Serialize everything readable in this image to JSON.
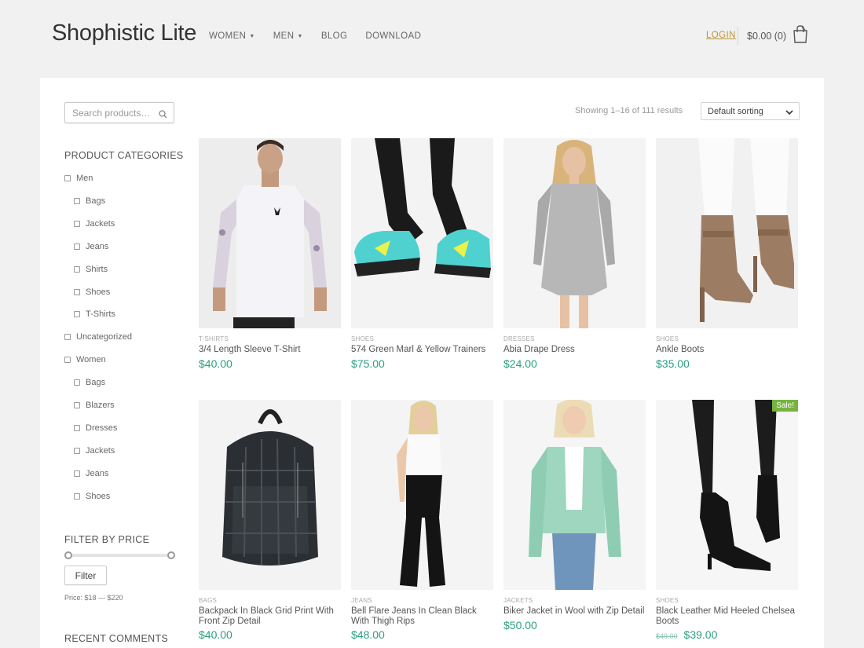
{
  "site": {
    "title": "Shophistic Lite",
    "nav": [
      {
        "label": "WOMEN",
        "dropdown": true
      },
      {
        "label": "MEN",
        "dropdown": true
      },
      {
        "label": "BLOG",
        "dropdown": false
      },
      {
        "label": "DOWNLOAD",
        "dropdown": false
      }
    ],
    "login": "LOGIN",
    "cart": "$0.00 (0)"
  },
  "sidebar": {
    "search_placeholder": "Search products…",
    "categories_title": "PRODUCT CATEGORIES",
    "categories": [
      {
        "label": "Men",
        "indent": 0
      },
      {
        "label": "Bags",
        "indent": 1
      },
      {
        "label": "Jackets",
        "indent": 1
      },
      {
        "label": "Jeans",
        "indent": 1
      },
      {
        "label": "Shirts",
        "indent": 1
      },
      {
        "label": "Shoes",
        "indent": 1
      },
      {
        "label": "T-Shirts",
        "indent": 1
      },
      {
        "label": "Uncategorized",
        "indent": 0
      },
      {
        "label": "Women",
        "indent": 0
      },
      {
        "label": "Bags",
        "indent": 1
      },
      {
        "label": "Blazers",
        "indent": 1
      },
      {
        "label": "Dresses",
        "indent": 1
      },
      {
        "label": "Jackets",
        "indent": 1
      },
      {
        "label": "Jeans",
        "indent": 1
      },
      {
        "label": "Shoes",
        "indent": 1
      }
    ],
    "filter_title": "FILTER BY PRICE",
    "filter_button": "Filter",
    "price_range": "Price: $18 — $220",
    "recent_title": "RECENT COMMENTS"
  },
  "toolbar": {
    "results": "Showing 1–16 of 111 results",
    "sort": "Default sorting"
  },
  "colors": {
    "price": "#2aa07f",
    "login": "#b8953a",
    "sale_badge": "#76b33f"
  },
  "products": [
    {
      "category": "T-SHIRTS",
      "name": "3/4 Length Sleeve T-Shirt",
      "price": "$40.00",
      "old_price": "",
      "sale": ""
    },
    {
      "category": "SHOES",
      "name": "574 Green Marl & Yellow Trainers",
      "price": "$75.00",
      "old_price": "",
      "sale": ""
    },
    {
      "category": "DRESSES",
      "name": "Abia Drape Dress",
      "price": "$24.00",
      "old_price": "",
      "sale": ""
    },
    {
      "category": "SHOES",
      "name": "Ankle Boots",
      "price": "$35.00",
      "old_price": "",
      "sale": ""
    },
    {
      "category": "BAGS",
      "name": "Backpack In Black Grid Print With Front Zip Detail",
      "price": "$40.00",
      "old_price": "",
      "sale": ""
    },
    {
      "category": "JEANS",
      "name": "Bell Flare Jeans In Clean Black With Thigh Rips",
      "price": "$48.00",
      "old_price": "",
      "sale": ""
    },
    {
      "category": "JACKETS",
      "name": "Biker Jacket in Wool with Zip Detail",
      "price": "$50.00",
      "old_price": "",
      "sale": ""
    },
    {
      "category": "SHOES",
      "name": "Black Leather Mid Heeled Chelsea Boots",
      "price": "$39.00",
      "old_price": "$49.00",
      "sale": "Sale!"
    }
  ]
}
